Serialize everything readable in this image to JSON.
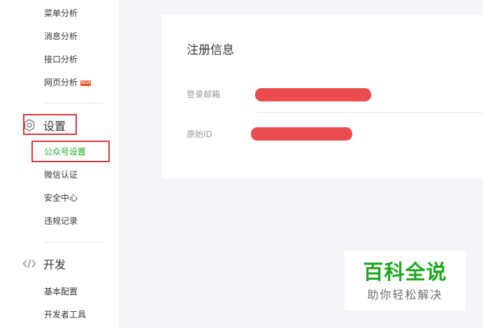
{
  "sidebar": {
    "stats_items": [
      {
        "label": "菜单分析"
      },
      {
        "label": "消息分析"
      },
      {
        "label": "接口分析"
      },
      {
        "label": "网页分析",
        "badge": "NEW"
      }
    ],
    "settings": {
      "title": "设置",
      "icon": "gear-icon",
      "items": [
        {
          "label": "公众号设置",
          "active": true
        },
        {
          "label": "微信认证"
        },
        {
          "label": "安全中心"
        },
        {
          "label": "违规记录"
        }
      ]
    },
    "develop": {
      "title": "开发",
      "icon": "code-icon",
      "items": [
        {
          "label": "基本配置"
        },
        {
          "label": "开发者工具"
        }
      ]
    }
  },
  "main": {
    "section_title": "注册信息",
    "fields": [
      {
        "label": "登录邮箱"
      },
      {
        "label": "原始ID"
      }
    ]
  },
  "watermark": {
    "title": "百科全说",
    "subtitle": "助你轻松解决"
  },
  "colors": {
    "accent": "#1aad19",
    "highlight_box": "#d9383a",
    "redaction": "#e94b4f",
    "badge": "#e8531d"
  }
}
